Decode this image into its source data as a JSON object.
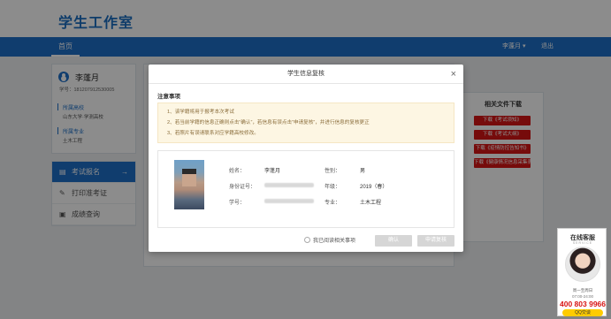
{
  "header": {
    "title": "学生工作室",
    "nav_home": "首页",
    "user_name": "李蓬月",
    "user_caret": "▾",
    "logout": "退出"
  },
  "profile": {
    "name": "李蓬月",
    "student_id": "学号：181207912530005",
    "school_label": "所属高校",
    "school_value": "山东大学·学测高校",
    "major_label": "所属专业",
    "major_value": "土木工程"
  },
  "menu": {
    "items": [
      {
        "label": "考试报名",
        "icon": "register-icon",
        "glyph": "▤",
        "active": true
      },
      {
        "label": "打印准考证",
        "icon": "pen-icon",
        "glyph": "✎",
        "active": false
      },
      {
        "label": "成绩查询",
        "icon": "search-doc-icon",
        "glyph": "▣",
        "active": false
      }
    ],
    "active_arrow": "→"
  },
  "docs": {
    "title": "相关文件下载",
    "buttons": [
      "下载《考试须知》",
      "下载《考试大纲》",
      "下载《疫情防控告知书》",
      "下载《健康情况信息采集表》"
    ]
  },
  "modal": {
    "title": "学生信息复核",
    "close": "×",
    "notice_heading": "注意事项",
    "notices": [
      "1、该学籍将用于报考本次考试",
      "2、若当前学籍的信息正确则点击“确认”，若信息有误点击“申请复核”，并进行信息的复核更正",
      "3、若照片有误请联系对应学籍高校修改。"
    ],
    "fields": {
      "name_label": "姓名：",
      "name_value": "李蓬月",
      "gender_label": "性别：",
      "gender_value": "男",
      "id_label": "身份证号：",
      "grade_label": "年级：",
      "grade_value": "2019（春）",
      "student_no_label": "学号：",
      "major_label": "专业：",
      "major_value": "土木工程"
    },
    "agree_text": "我已阅读相关事项",
    "confirm_button": "确认",
    "apply_button": "申请复核"
  },
  "service": {
    "title": "在线客服",
    "subtitle": "SERVICE",
    "hours_days": "周一至周日",
    "hours_time": "07:00-24:00",
    "phone": "400 803 9966",
    "qq_label": "QQ交谈"
  },
  "colors": {
    "primary": "#1e70c8",
    "danger": "#d81414",
    "notice_bg": "#fdf6e3"
  }
}
